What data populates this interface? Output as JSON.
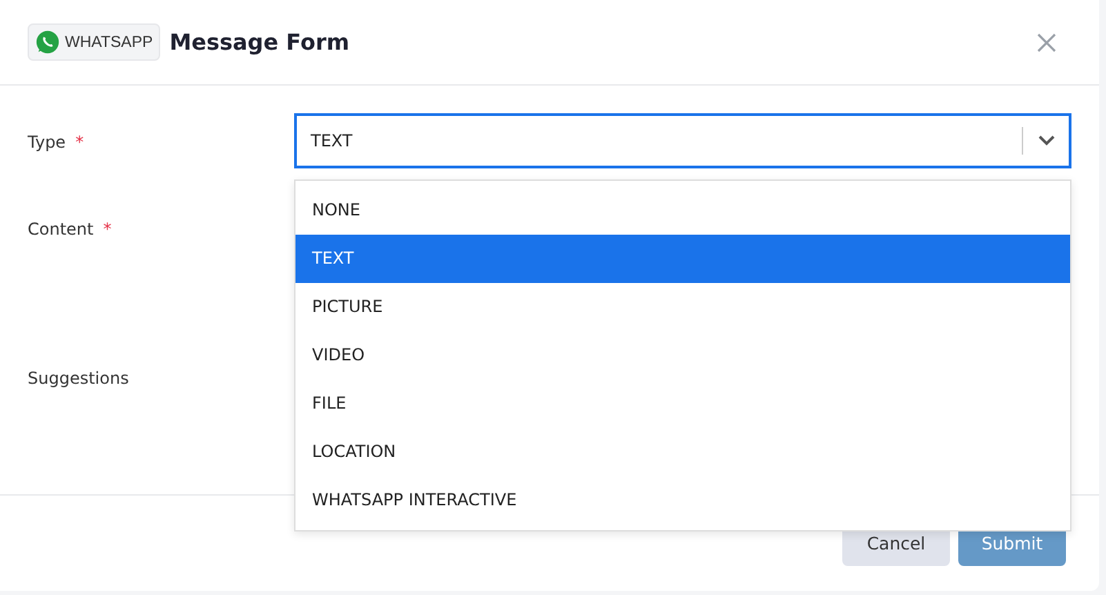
{
  "header": {
    "badge": "WHATSAPP",
    "title": "Message Form"
  },
  "fields": [
    {
      "label": "Type",
      "required_mark": "*"
    },
    {
      "label": "Content",
      "required_mark": "*"
    },
    {
      "label": "Suggestions"
    }
  ],
  "type_select": {
    "value": "TEXT",
    "open": true,
    "options": [
      {
        "label": "NONE",
        "selected": false
      },
      {
        "label": "TEXT",
        "selected": true
      },
      {
        "label": "PICTURE",
        "selected": false
      },
      {
        "label": "VIDEO",
        "selected": false
      },
      {
        "label": "FILE",
        "selected": false
      },
      {
        "label": "LOCATION",
        "selected": false
      },
      {
        "label": "WHATSAPP INTERACTIVE",
        "selected": false
      }
    ]
  },
  "buttons": [
    {
      "label": "Cancel",
      "kind": "secondary"
    },
    {
      "label": "Submit",
      "kind": "primary"
    }
  ]
}
